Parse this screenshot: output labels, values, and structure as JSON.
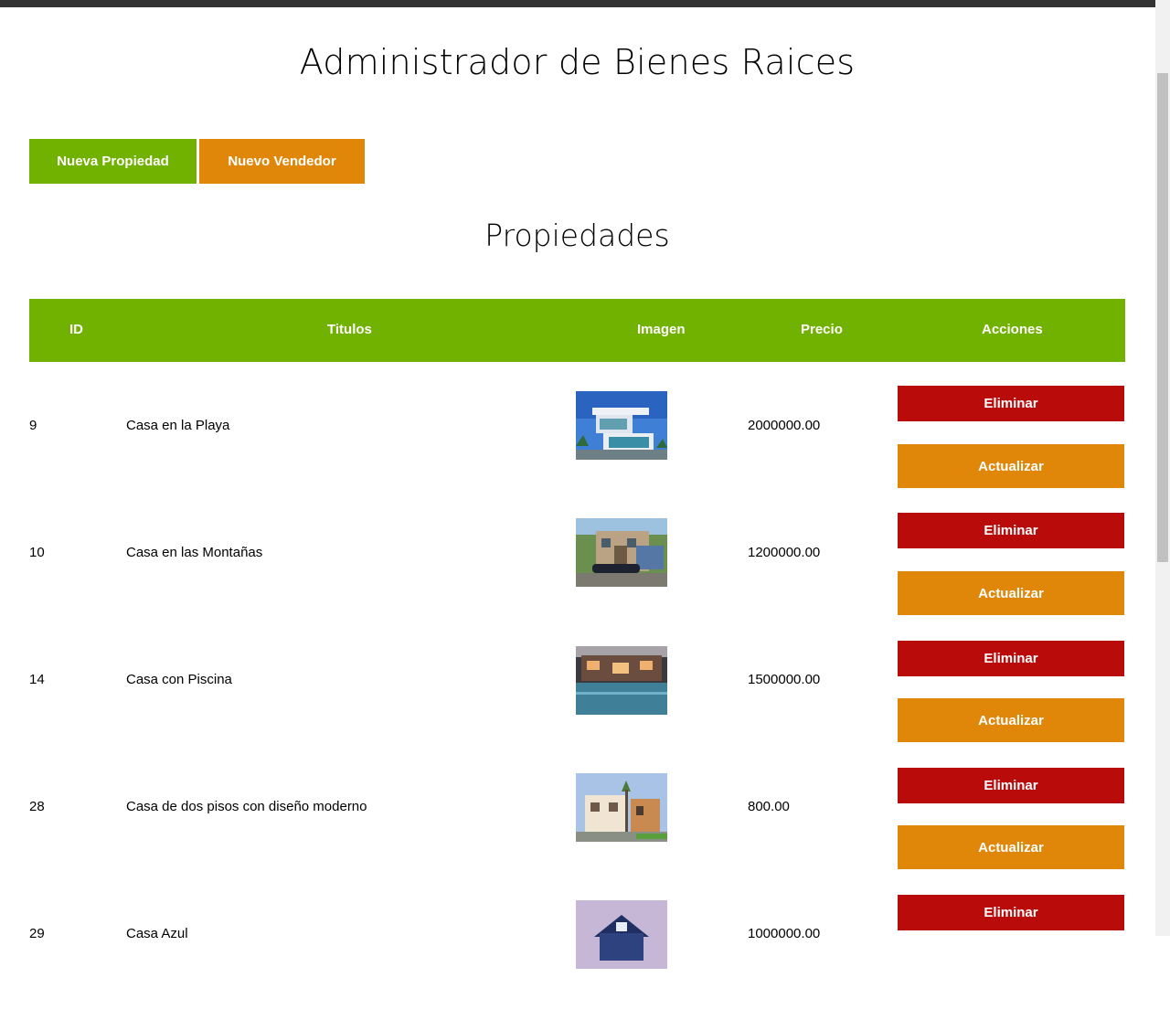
{
  "header": {
    "title": "Administrador de Bienes Raices"
  },
  "actions": {
    "new_property": "Nueva Propiedad",
    "new_seller": "Nuevo Vendedor"
  },
  "section_title": "Propiedades",
  "table": {
    "columns": [
      "ID",
      "Titulos",
      "Imagen",
      "Precio",
      "Acciones"
    ],
    "delete_label": "Eliminar",
    "update_label": "Actualizar",
    "rows": [
      {
        "id": "9",
        "title": "Casa en la Playa",
        "price": "2000000.00",
        "image_icon": "beach-house-photo"
      },
      {
        "id": "10",
        "title": "Casa en las Montañas",
        "price": "1200000.00",
        "image_icon": "mountain-house-photo"
      },
      {
        "id": "14",
        "title": "Casa con Piscina",
        "price": "1500000.00",
        "image_icon": "pool-house-photo"
      },
      {
        "id": "28",
        "title": "Casa de dos pisos con diseño moderno",
        "price": "800.00",
        "image_icon": "modern-house-photo"
      },
      {
        "id": "29",
        "title": "Casa Azul",
        "price": "1000000.00",
        "image_icon": "blue-house-photo"
      }
    ]
  },
  "colors": {
    "green": "#71b100",
    "orange": "#e08709",
    "red": "#ba0b0b"
  }
}
